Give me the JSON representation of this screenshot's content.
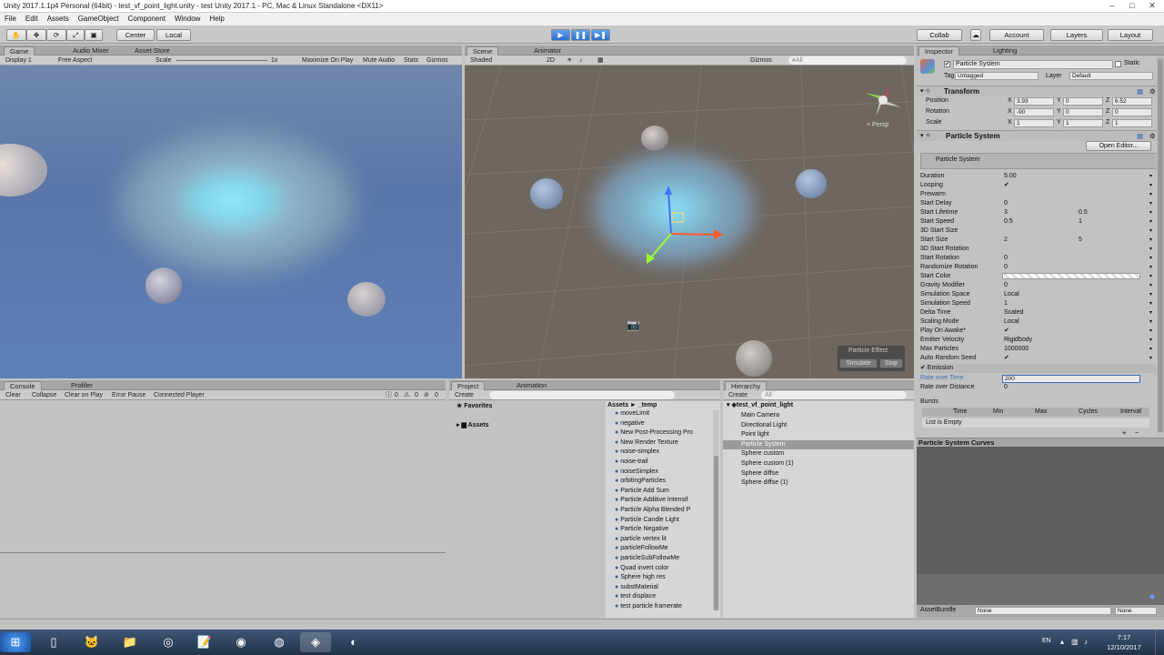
{
  "title": "Unity 2017.1.1p4 Personal (64bit) - test_vf_point_light.unity - test Unity 2017.1 - PC, Mac & Linux Standalone <DX11>",
  "menu": [
    "File",
    "Edit",
    "Assets",
    "GameObject",
    "Component",
    "Window",
    "Help"
  ],
  "toolbar": {
    "center": "Center",
    "local": "Local",
    "collab": "Collab",
    "account": "Account",
    "layers": "Layers",
    "layout": "Layout"
  },
  "game": {
    "tabs": [
      "Game",
      "Audio Mixer",
      "Asset Store"
    ],
    "display": "Display 1",
    "aspect": "Free Aspect",
    "scale_label": "Scale",
    "scale_val": "1x",
    "buttons": [
      "Maximize On Play",
      "Mute Audio",
      "Stats",
      "Gizmos"
    ]
  },
  "scene": {
    "tabs": [
      "Scene",
      "Animator"
    ],
    "shaded": "Shaded",
    "mode2d": "2D",
    "gizmos": "Gizmos",
    "search": "All",
    "persp": "< Persp",
    "pe_title": "Particle Effect",
    "simulate": "Simulate",
    "stop": "Stop"
  },
  "console": {
    "tabs": [
      "Console",
      "Profiler"
    ],
    "buttons": [
      "Clear",
      "Collapse",
      "Clear on Play",
      "Error Pause",
      "Connected Player"
    ],
    "counts": [
      "0",
      "0",
      "0"
    ]
  },
  "project": {
    "tabs": [
      "Project",
      "Animation"
    ],
    "create": "Create",
    "favorites": "Favorites",
    "assets": "Assets",
    "breadcrumb": "Assets ► _temp",
    "items": [
      "moveLimit",
      "negative",
      "New Post-Processing Pro",
      "New Render Texture",
      "noise-simplex",
      "noise-trail",
      "noiseSimplex",
      "orbitingParticles",
      "Particle Add Sum",
      "Particle Additive Intensif",
      "Particle Alpha Blended P",
      "Particle Candle Light",
      "Particle Negative",
      "particle vertex lit",
      "particleFollowMe",
      "particleSubFollowMe",
      "Quad invert color",
      "Sphere high res",
      "substMaterial",
      "test displace",
      "test particle framerate"
    ]
  },
  "hierarchy": {
    "tab": "Hierarchy",
    "create": "Create",
    "search": "All",
    "scene": "test_vf_point_light",
    "items": [
      "Main Camera",
      "Directional Light",
      "Point light",
      "Particle System",
      "Sphere custom",
      "Sphere custom (1)",
      "Sphere diffse",
      "Sphere diffse (1)"
    ],
    "selected": 3
  },
  "inspector": {
    "tabs": [
      "Inspector",
      "Lighting"
    ],
    "object": "Particle System",
    "static": "Static",
    "tag_label": "Tag",
    "tag": "Untagged",
    "layer_label": "Layer",
    "layer": "Default",
    "transform": {
      "title": "Transform",
      "rows": [
        {
          "label": "Position",
          "x": "3.93",
          "y": "0",
          "z": "6.52"
        },
        {
          "label": "Rotation",
          "x": "-90",
          "y": "0",
          "z": "0"
        },
        {
          "label": "Scale",
          "x": "1",
          "y": "1",
          "z": "1"
        }
      ]
    },
    "ps_title": "Particle System",
    "open_editor": "Open Editor...",
    "ps_module": "Particle System",
    "props": [
      {
        "label": "Duration",
        "v1": "5.00",
        "v2": ""
      },
      {
        "label": "Looping",
        "v1": "✔",
        "v2": ""
      },
      {
        "label": "Prewarm",
        "v1": "",
        "v2": ""
      },
      {
        "label": "Start Delay",
        "v1": "0",
        "v2": ""
      },
      {
        "label": "Start Lifetime",
        "v1": "3",
        "v2": "0.5"
      },
      {
        "label": "Start Speed",
        "v1": "0.5",
        "v2": "1"
      },
      {
        "label": "3D Start Size",
        "v1": "",
        "v2": ""
      },
      {
        "label": "Start Size",
        "v1": "2",
        "v2": "5"
      },
      {
        "label": "3D Start Rotation",
        "v1": "",
        "v2": ""
      },
      {
        "label": "Start Rotation",
        "v1": "0",
        "v2": ""
      },
      {
        "label": "Randomize Rotation",
        "v1": "0",
        "v2": ""
      },
      {
        "label": "Start Color",
        "v1": "",
        "v2": ""
      },
      {
        "label": "Gravity Modifier",
        "v1": "0",
        "v2": ""
      },
      {
        "label": "Simulation Space",
        "v1": "Local",
        "v2": ""
      },
      {
        "label": "Simulation Speed",
        "v1": "1",
        "v2": ""
      },
      {
        "label": "Delta Time",
        "v1": "Scaled",
        "v2": ""
      },
      {
        "label": "Scaling Mode",
        "v1": "Local",
        "v2": ""
      },
      {
        "label": "Play On Awake*",
        "v1": "✔",
        "v2": ""
      },
      {
        "label": "Emitter Velocity",
        "v1": "Rigidbody",
        "v2": ""
      },
      {
        "label": "Max Particles",
        "v1": "1000000",
        "v2": ""
      },
      {
        "label": "Auto Random Seed",
        "v1": "✔",
        "v2": ""
      }
    ],
    "emission": "Emission",
    "rate_time_label": "Rate over Time",
    "rate_time": "200",
    "rate_dist_label": "Rate over Distance",
    "rate_dist": "0",
    "bursts": "Bursts",
    "burst_cols": [
      "Time",
      "Min",
      "Max",
      "Cycles",
      "Interval"
    ],
    "list_empty": "List is Empty"
  },
  "curves": {
    "title": "Particle System Curves"
  },
  "assetbundle": {
    "label": "AssetBundle",
    "v1": "None",
    "v2": "None"
  },
  "taskbar": {
    "lang": "EN",
    "time": "7:17",
    "date": "12/10/2017"
  },
  "colors": {
    "selection": "#3d6fb6",
    "play": "#2a6fd0"
  }
}
